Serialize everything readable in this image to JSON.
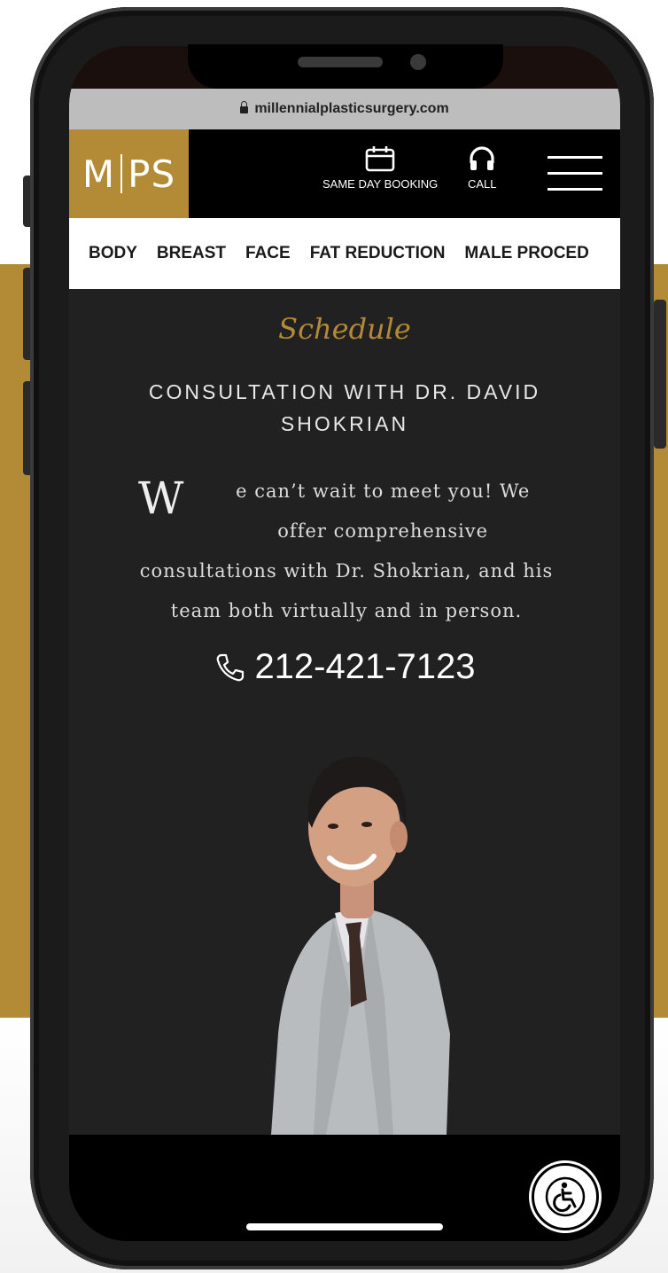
{
  "browser": {
    "url": "millennialplasticsurgery.com"
  },
  "header": {
    "logo_left": "M",
    "logo_right": "PS",
    "booking_label": "SAME DAY BOOKING",
    "call_label": "CALL"
  },
  "nav": {
    "items": [
      "BODY",
      "BREAST",
      "FACE",
      "FAT REDUCTION",
      "MALE PROCED"
    ]
  },
  "hero": {
    "script_title": "Schedule",
    "heading": "CONSULTATION WITH DR. DAVID SHOKRIAN",
    "dropcap": "W",
    "body": "e can’t wait to meet you! We offer comprehensive consultations with Dr. Shokrian, and his team both virtually and in person.",
    "phone": "212-421-7123"
  },
  "colors": {
    "brand_gold": "#b38a35",
    "content_bg": "#212121",
    "header_bg": "#000000"
  }
}
